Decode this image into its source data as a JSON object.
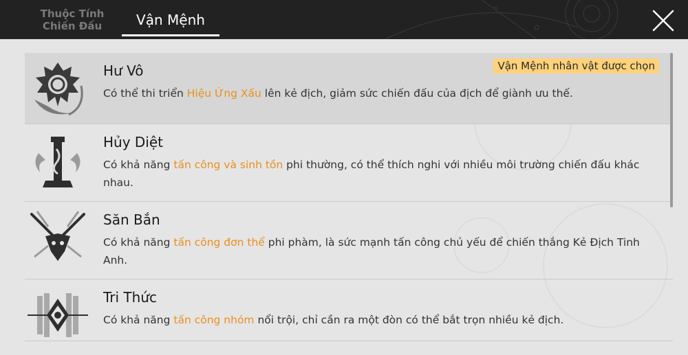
{
  "tabs": {
    "combat_label": "Thuộc Tính\nChiến Đấu",
    "destiny_label": "Vận Mệnh"
  },
  "colors": {
    "highlight": "#e8901e",
    "badge_bg": "#ffd27a",
    "topbar_bg": "#222222"
  },
  "paths": [
    {
      "title": "Hư Vô",
      "icon": "nihility-icon",
      "selected": true,
      "badge": "Vận Mệnh nhân vật được chọn",
      "desc_before": "Có thể thi triển ",
      "desc_highlight": "Hiệu Ứng Xấu",
      "desc_after": " lên kẻ địch, giảm sức chiến đấu của địch để giành ưu thế."
    },
    {
      "title": "Hủy Diệt",
      "icon": "destruction-icon",
      "selected": false,
      "desc_before": "Có khả năng ",
      "desc_highlight": "tấn công và sinh tồn",
      "desc_after": " phi thường, có thể thích nghi với nhiều môi trường chiến đấu khác nhau."
    },
    {
      "title": "Săn Bắn",
      "icon": "hunt-icon",
      "selected": false,
      "desc_before": "Có khả năng ",
      "desc_highlight": "tấn công đơn thể",
      "desc_after": " phi phàm, là sức mạnh tấn công chủ yếu để chiến thắng Kẻ Địch Tinh Anh."
    },
    {
      "title": "Tri Thức",
      "icon": "erudition-icon",
      "selected": false,
      "desc_before": "Có khả năng ",
      "desc_highlight": "tấn công nhóm",
      "desc_after": " nổi trội, chỉ cần ra một đòn có thể bắt trọn nhiều kẻ địch."
    }
  ]
}
